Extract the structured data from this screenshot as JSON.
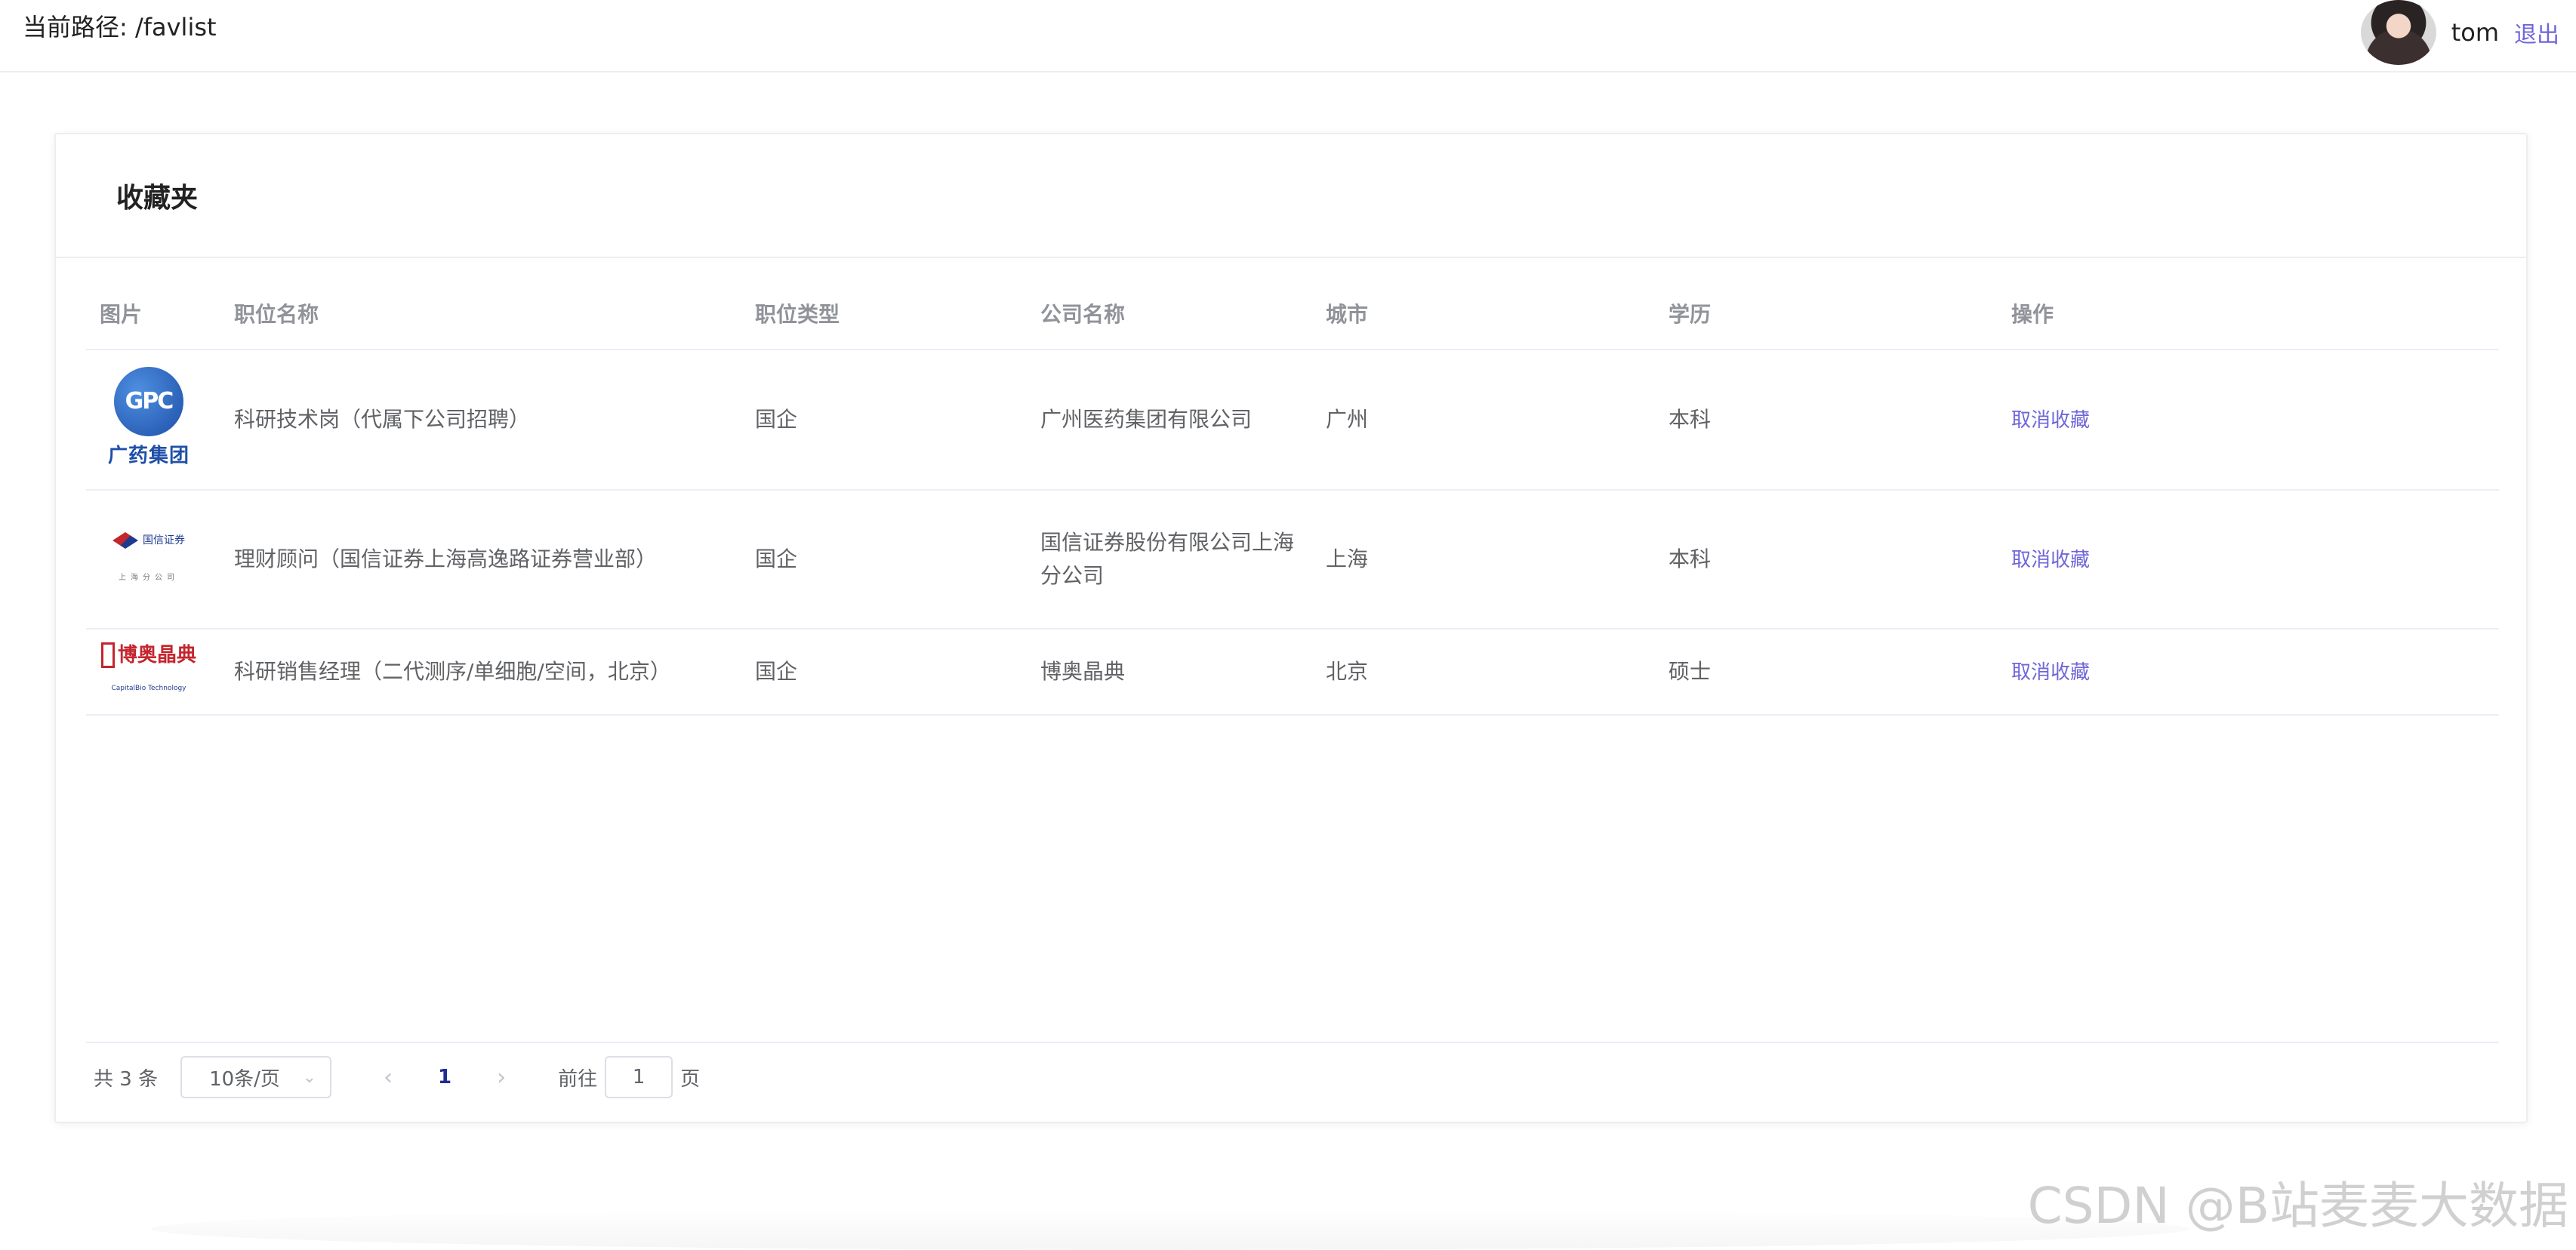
{
  "header": {
    "path_label": "当前路径: /favlist",
    "username": "tom",
    "logout": "退出"
  },
  "card": {
    "title": "收藏夹"
  },
  "table": {
    "columns": [
      "图片",
      "职位名称",
      "职位类型",
      "公司名称",
      "城市",
      "学历",
      "操作"
    ],
    "rows": [
      {
        "logo": "gpc-logo",
        "job": "科研技术岗（代属下公司招聘）",
        "type": "国企",
        "company": "广州医药集团有限公司",
        "city": "广州",
        "education": "本科",
        "action": "取消收藏"
      },
      {
        "logo": "guosen-logo",
        "job": "理财顾问（国信证券上海高逸路证券营业部）",
        "type": "国企",
        "company": "国信证券股份有限公司上海分公司",
        "city": "上海",
        "education": "本科",
        "action": "取消收藏"
      },
      {
        "logo": "boao-logo",
        "job": "科研销售经理（二代测序/单细胞/空间，北京）",
        "type": "国企",
        "company": "博奥晶典",
        "city": "北京",
        "education": "硕士",
        "action": "取消收藏"
      }
    ]
  },
  "logos": {
    "gpc_globe": "GPC",
    "gpc_text": "广药集团",
    "guosen_name": "国信证券",
    "guosen_sub": "上海分公司",
    "boao_name": "博奥晶典",
    "boao_sub": "CapitalBio Technology"
  },
  "pagination": {
    "total": "共 3 条",
    "page_size": "10条/页",
    "current_page": "1",
    "goto_label": "前往",
    "goto_value": "1",
    "goto_suffix": "页"
  },
  "watermark": "CSDN @B站麦麦大数据",
  "colors": {
    "link": "#6f66d8",
    "current_page": "#1f2d8f"
  }
}
